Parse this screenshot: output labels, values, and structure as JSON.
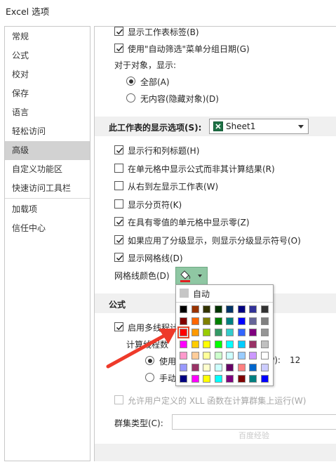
{
  "window": {
    "title": "Excel 选项"
  },
  "nav": {
    "items": [
      {
        "label": "常规",
        "active": false
      },
      {
        "label": "公式",
        "active": false
      },
      {
        "label": "校对",
        "active": false
      },
      {
        "label": "保存",
        "active": false
      },
      {
        "label": "语言",
        "active": false
      },
      {
        "label": "轻松访问",
        "active": false
      },
      {
        "label": "高级",
        "active": true
      },
      {
        "label": "自定义功能区",
        "active": false
      },
      {
        "label": "快速访问工具栏",
        "active": false
      },
      {
        "label": "加载项",
        "active": false
      },
      {
        "label": "信任中心",
        "active": false
      }
    ]
  },
  "workbook_options": {
    "show_sheet_tabs": {
      "label": "显示工作表标签(B)",
      "checked": true
    },
    "group_dates": {
      "label": "使用\"自动筛选\"菜单分组日期(G)",
      "checked": true
    },
    "objects_label": "对于对象，显示:",
    "radio_all": {
      "label": "全部(A)",
      "selected": true
    },
    "radio_none": {
      "label": "无内容(隐藏对象)(D)",
      "selected": false
    }
  },
  "worksheet_section": {
    "header": "此工作表的显示选项(S):",
    "sheet_dropdown": "Sheet1",
    "options": [
      {
        "label": "显示行和列标题(H)",
        "checked": true
      },
      {
        "label": "在单元格中显示公式而非其计算结果(R)",
        "checked": false
      },
      {
        "label": "从右到左显示工作表(W)",
        "checked": false
      },
      {
        "label": "显示分页符(K)",
        "checked": false
      },
      {
        "label": "在具有零值的单元格中显示零(Z)",
        "checked": true
      },
      {
        "label": "如果应用了分级显示，则显示分级显示符号(O)",
        "checked": true
      },
      {
        "label": "显示网格线(D)",
        "checked": true
      }
    ],
    "gridline_color_label": "网格线颜色(D)"
  },
  "formula_section": {
    "header": "公式",
    "multithread": {
      "label": "启用多线程计",
      "checked": true
    },
    "threads_label": "计算线程数",
    "radio_use": {
      "label": "使用",
      "selected": true
    },
    "radio_manual": {
      "label": "手动",
      "selected": false
    },
    "processors_suffix": "P):",
    "processors_value": "12",
    "xll": {
      "label": "允许用户定义的 XLL 函数在计算群集上运行(W)",
      "checked": false
    },
    "cluster_type_label": "群集类型(C):"
  },
  "color_popup": {
    "auto_label": "自动",
    "selected_color": "#ff0000",
    "swatches": [
      [
        "#000000",
        "#993300",
        "#333300",
        "#003300",
        "#003366",
        "#000080",
        "#333399",
        "#333333"
      ],
      [
        "#800000",
        "#ff6600",
        "#808000",
        "#008000",
        "#008080",
        "#0000ff",
        "#666699",
        "#808080"
      ],
      [
        "#ff0000",
        "#ff9900",
        "#99cc00",
        "#339966",
        "#33cccc",
        "#3366ff",
        "#800080",
        "#969696"
      ],
      [
        "#ff00ff",
        "#ffcc00",
        "#ffff00",
        "#00ff00",
        "#00ffff",
        "#00ccff",
        "#993366",
        "#c0c0c0"
      ],
      [
        "#ff99cc",
        "#ffcc99",
        "#ffff99",
        "#ccffcc",
        "#ccffff",
        "#99ccff",
        "#cc99ff",
        "#ffffff"
      ],
      [
        "#9999ff",
        "#993366",
        "#ffffcc",
        "#ccffff",
        "#660066",
        "#ff8080",
        "#0066cc",
        "#ccccff"
      ],
      [
        "#000080",
        "#ff00ff",
        "#ffff00",
        "#00ffff",
        "#800080",
        "#800000",
        "#008080",
        "#0000ff"
      ]
    ]
  },
  "watermark": "百度经验"
}
